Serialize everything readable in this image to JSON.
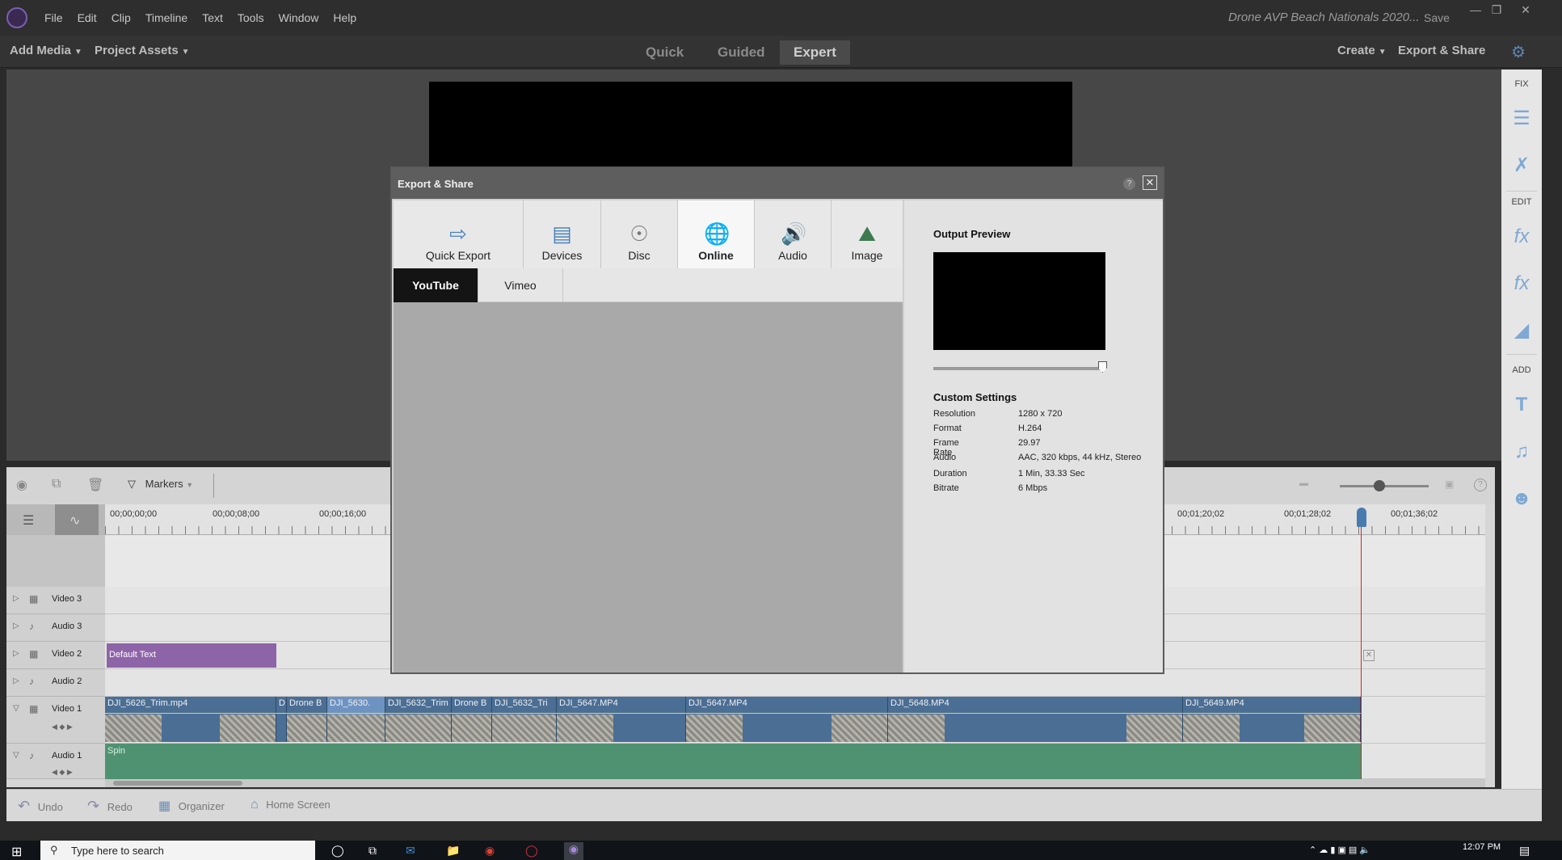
{
  "app": {
    "menu": [
      "File",
      "Edit",
      "Clip",
      "Timeline",
      "Text",
      "Tools",
      "Window",
      "Help"
    ],
    "document_title": "Drone AVP Beach Nationals 2020...",
    "save_label": "Save"
  },
  "toolbar": {
    "add_media": "Add Media",
    "project_assets": "Project Assets",
    "modes": [
      "Quick",
      "Guided",
      "Expert"
    ],
    "active_mode": "Expert",
    "create": "Create",
    "export_share": "Export & Share"
  },
  "right_panel": {
    "fix": "FIX",
    "edit": "EDIT",
    "add": "ADD"
  },
  "timeline": {
    "markers": "Markers",
    "ruler_labels_left": [
      "00;00;00;00",
      "00;00;08;00",
      "00;00;16;00"
    ],
    "ruler_labels_right": [
      "00;01;20;02",
      "00;01;28;02",
      "00;01;36;02"
    ],
    "tracks": [
      {
        "label": "Video 3"
      },
      {
        "label": "Audio 3"
      },
      {
        "label": "Video 2"
      },
      {
        "label": "Audio 2"
      },
      {
        "label": "Video 1"
      },
      {
        "label": "Audio 1"
      }
    ],
    "text_clip": "Default Text",
    "audio_clip": "Spin",
    "video_clips": [
      "DJI_5626_Trim.mp4",
      "D",
      "Drone B",
      "DJI_5630.",
      "DJI_5632_Trim",
      "Drone B",
      "DJI_5632_Tri",
      "DJI_5647.MP4",
      "DJI_5647.MP4",
      "DJI_5648.MP4",
      "DJI_5649.MP4"
    ]
  },
  "bottom_bar": {
    "undo": "Undo",
    "redo": "Redo",
    "organizer": "Organizer",
    "home_screen": "Home Screen"
  },
  "taskbar": {
    "search_placeholder": "Type here to search",
    "time": "12:07 PM"
  },
  "dialog": {
    "title": "Export & Share",
    "help": "?",
    "close": "✕",
    "categories": [
      "Quick Export",
      "Devices",
      "Disc",
      "Online",
      "Audio",
      "Image"
    ],
    "active_category": "Online",
    "sub_tabs": [
      "YouTube",
      "Vimeo"
    ],
    "active_sub_tab": "YouTube",
    "output_preview_title": "Output Preview",
    "custom_settings_title": "Custom Settings",
    "settings": [
      {
        "key": "Resolution",
        "value": "1280 x 720"
      },
      {
        "key": "Format",
        "value": "H.264"
      },
      {
        "key": "Frame Rate",
        "value": "29.97"
      },
      {
        "key": "Audio",
        "value": "AAC, 320 kbps, 44 kHz, Stereo"
      },
      {
        "key": "Duration",
        "value": "1 Min, 33.33 Sec"
      },
      {
        "key": "Bitrate",
        "value": "6 Mbps"
      }
    ]
  }
}
